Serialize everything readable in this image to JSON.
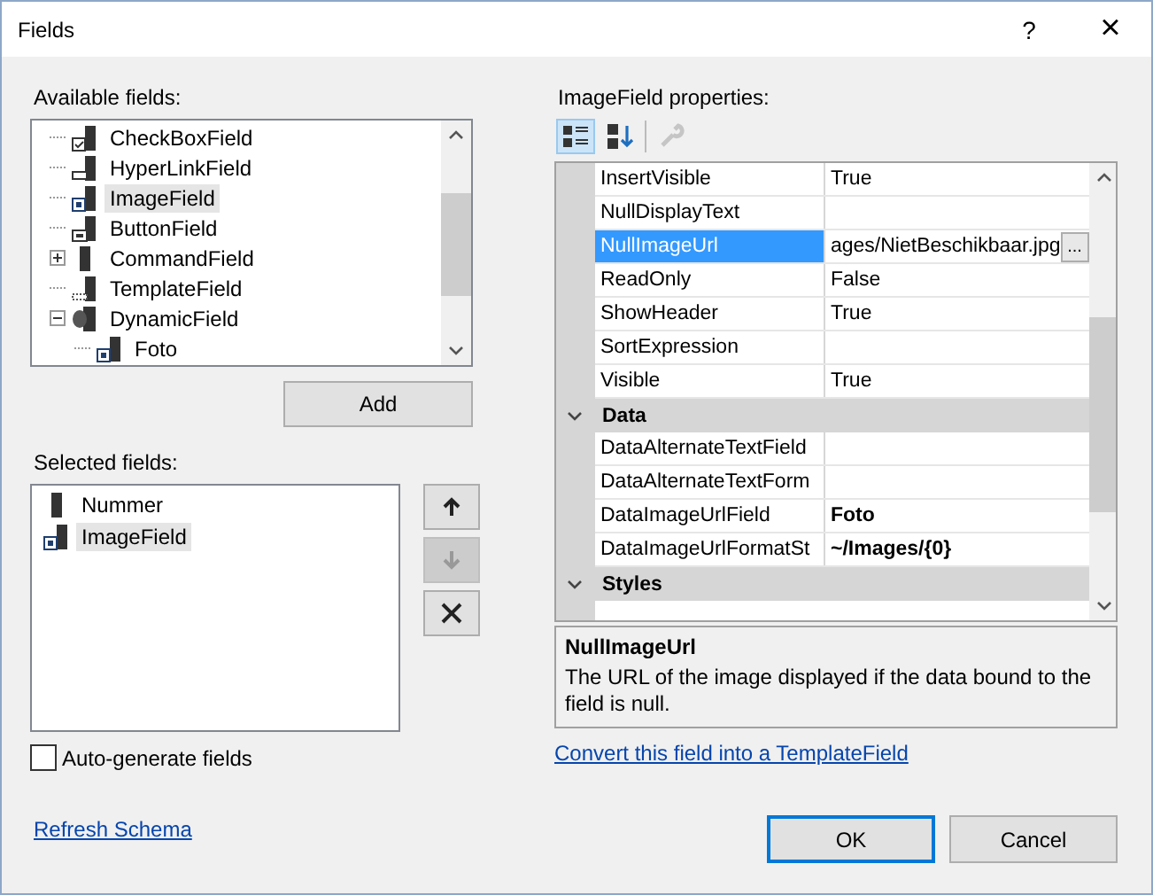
{
  "window": {
    "title": "Fields",
    "help": "?",
    "close": "×"
  },
  "available_fields": {
    "label": "Available fields:",
    "items": [
      {
        "label": "CheckBoxField",
        "kind": "checkbox",
        "selected": false
      },
      {
        "label": "HyperLinkField",
        "kind": "link",
        "selected": false
      },
      {
        "label": "ImageField",
        "kind": "image",
        "selected": true
      },
      {
        "label": "ButtonField",
        "kind": "button",
        "selected": false
      },
      {
        "label": "CommandField",
        "kind": "plain",
        "selected": false,
        "expanded": false
      },
      {
        "label": "TemplateField",
        "kind": "template",
        "selected": false
      },
      {
        "label": "DynamicField",
        "kind": "dynamic",
        "selected": false,
        "expanded": true,
        "children": [
          {
            "label": "Foto",
            "kind": "image",
            "selected": false
          }
        ]
      }
    ]
  },
  "add_button": "Add",
  "selected_fields": {
    "label": "Selected fields:",
    "items": [
      {
        "label": "Nummer",
        "kind": "plain",
        "selected": false
      },
      {
        "label": "ImageField",
        "kind": "image",
        "selected": true
      }
    ]
  },
  "side_buttons": [
    {
      "kind": "up",
      "disabled": false
    },
    {
      "kind": "down",
      "disabled": true
    },
    {
      "kind": "delete",
      "disabled": false
    }
  ],
  "auto_generate": {
    "label": "Auto-generate fields",
    "checked": false
  },
  "refresh_link": "Refresh Schema",
  "properties": {
    "label": "ImageField properties:",
    "toolbar": [
      {
        "kind": "categorized",
        "selected": true,
        "disabled": false
      },
      {
        "kind": "alphabetical",
        "selected": false,
        "disabled": false
      },
      {
        "kind": "wrench",
        "selected": false,
        "disabled": true
      }
    ],
    "rows": [
      {
        "kind": "property",
        "name": "InsertVisible",
        "value": "True",
        "modified": false,
        "selected": false
      },
      {
        "kind": "property",
        "name": "NullDisplayText",
        "selected": false
      },
      {
        "kind": "property",
        "name": "NullImageUrl",
        "value": "ages/NietBeschikbaar.jpg",
        "modified": false,
        "selected": true,
        "browse": "..."
      },
      {
        "kind": "property",
        "name": "ReadOnly",
        "value": "False",
        "modified": false,
        "selected": false
      },
      {
        "kind": "property",
        "name": "ShowHeader",
        "value": "True",
        "modified": false,
        "selected": false
      },
      {
        "kind": "property",
        "name": "SortExpression",
        "selected": false
      },
      {
        "kind": "property",
        "name": "Visible",
        "value": "True",
        "modified": false,
        "selected": false
      },
      {
        "kind": "category",
        "name": "Data"
      },
      {
        "kind": "property",
        "name": "DataAlternateTextField",
        "selected": false
      },
      {
        "kind": "property",
        "name": "DataAlternateTextForm",
        "selected": false
      },
      {
        "kind": "property",
        "name": "DataImageUrlField",
        "value": "Foto",
        "modified": true,
        "selected": false
      },
      {
        "kind": "property",
        "name": "DataImageUrlFormatSt",
        "value": "~/Images/{0}",
        "modified": true,
        "selected": false
      },
      {
        "kind": "category",
        "name": "Styles"
      }
    ],
    "description": {
      "title": "NullImageUrl",
      "text": "The URL of the image displayed if the data bound to the field is null."
    },
    "convert_link": "Convert this field into a TemplateField"
  },
  "buttons": [
    {
      "label": "OK",
      "default": true
    },
    {
      "label": "Cancel",
      "default": false
    }
  ]
}
